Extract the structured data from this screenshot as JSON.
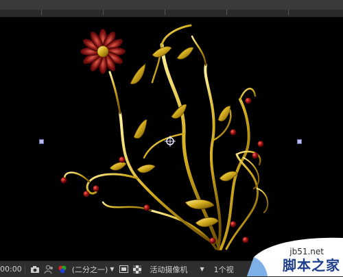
{
  "status_bar": {
    "timecode": "00:00",
    "resolution": "(二分之一)",
    "camera": "活动摄像机",
    "views": "1个视"
  },
  "watermark": {
    "url": "jb51.net",
    "brand": "脚本之家"
  },
  "icons": {
    "snapshot": "camera-icon",
    "show_snapshot": "snapshot-person-icon",
    "channel": "rgb-channel-icon",
    "region": "region-of-interest-icon",
    "transparency": "transparency-grid-icon"
  },
  "colors": {
    "viewer_bg": "#000000",
    "panel_bg": "#2e2e2e",
    "gold": "#d6b020",
    "berry": "#8a1010",
    "watermark_brand": "#1f3e8c"
  }
}
